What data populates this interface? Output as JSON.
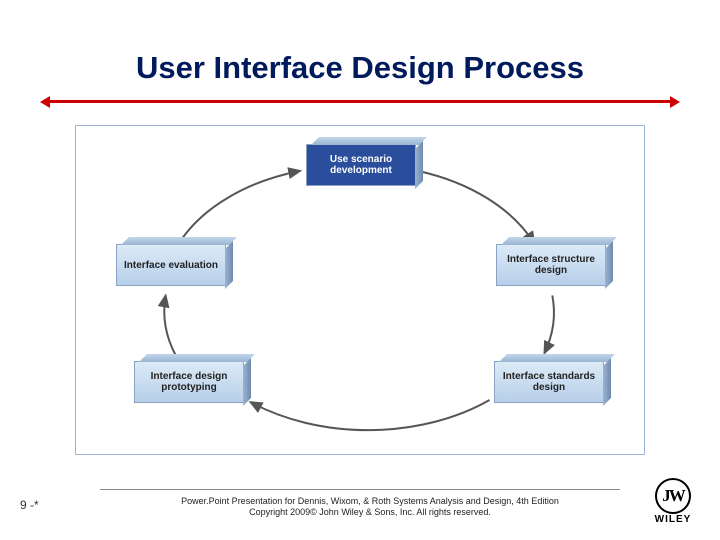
{
  "title": "User Interface Design Process",
  "diagram": {
    "cycle_nodes": [
      {
        "label": "Use scenario development"
      },
      {
        "label": "Interface structure design"
      },
      {
        "label": "Interface standards design"
      },
      {
        "label": "Interface design prototyping"
      },
      {
        "label": "Interface evaluation"
      }
    ]
  },
  "footer": {
    "page": "9 -*",
    "line1": "Power.Point Presentation for Dennis, Wixom, & Roth Systems Analysis and Design, 4th Edition",
    "line2": "Copyright 2009© John Wiley & Sons, Inc.  All rights reserved.",
    "logo_mark": "JW",
    "logo_text": "WILEY"
  }
}
